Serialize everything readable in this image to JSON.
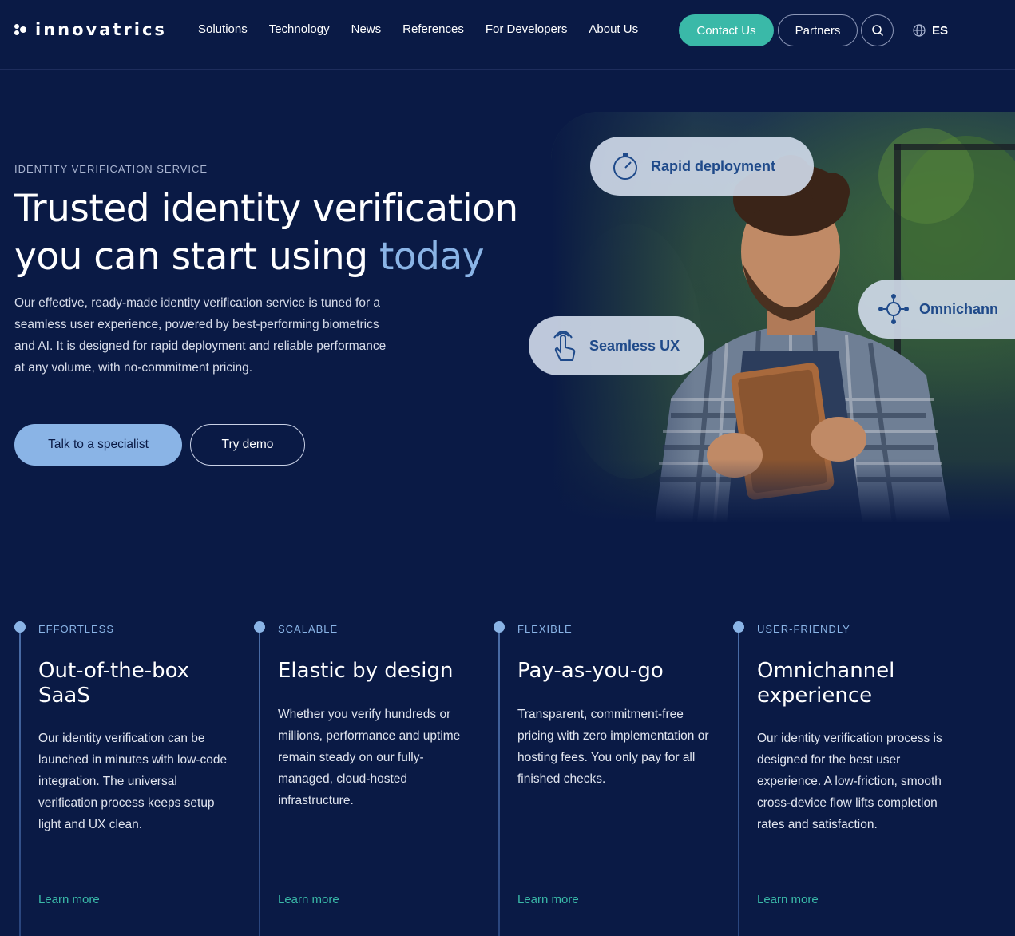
{
  "nav": {
    "logo_text": "innovatrics",
    "menu": [
      "Solutions",
      "Technology",
      "News",
      "References",
      "For Developers",
      "About Us"
    ],
    "contact_label": "Contact Us",
    "partners_label": "Partners",
    "language": "ES"
  },
  "hero": {
    "eyebrow": "IDENTITY VERIFICATION SERVICE",
    "title_line1": "Trusted identity verification",
    "title_line2": "you can start using ",
    "title_accent": "today",
    "description": "Our effective, ready-made identity verification service is tuned for a seamless user experience, powered by best-performing biometrics and AI. It is designed for rapid deployment and reliable performance at any volume, with no-commitment pricing.",
    "primary_button": "Talk to a specialist",
    "secondary_button": "Try demo",
    "pills": {
      "rapid": "Rapid deployment",
      "seamless": "Seamless UX",
      "omni": "Omnichann"
    }
  },
  "features": [
    {
      "tag": "EFFORTLESS",
      "title": "Out-of-the-box SaaS",
      "description": "Our identity verification can be launched in minutes with low-code integration. The universal verification process keeps setup light and UX clean.",
      "link": "Learn more"
    },
    {
      "tag": "SCALABLE",
      "title": "Elastic by design",
      "description": "Whether you verify hundreds or millions, performance and uptime remain steady on our fully-managed, cloud-hosted infrastructure.",
      "link": "Learn more"
    },
    {
      "tag": "FLEXIBLE",
      "title": "Pay-as-you-go",
      "description": "Transparent, commitment-free pricing with zero implementation or hosting fees. You only pay for all finished checks.",
      "link": "Learn more"
    },
    {
      "tag": "USER-FRIENDLY",
      "title": "Omnichannel experience",
      "description": "Our identity verification process is designed for the best user experience. A low-friction, smooth cross-device flow lifts completion rates and satisfaction.",
      "link": "Learn more"
    }
  ],
  "colors": {
    "background": "#0a1a45",
    "accent_blue": "#8ab4e6",
    "accent_teal": "#3ab9a8"
  },
  "icons": [
    "logo-mark",
    "search-icon",
    "globe-icon",
    "stopwatch-icon",
    "touch-icon",
    "network-icon"
  ]
}
